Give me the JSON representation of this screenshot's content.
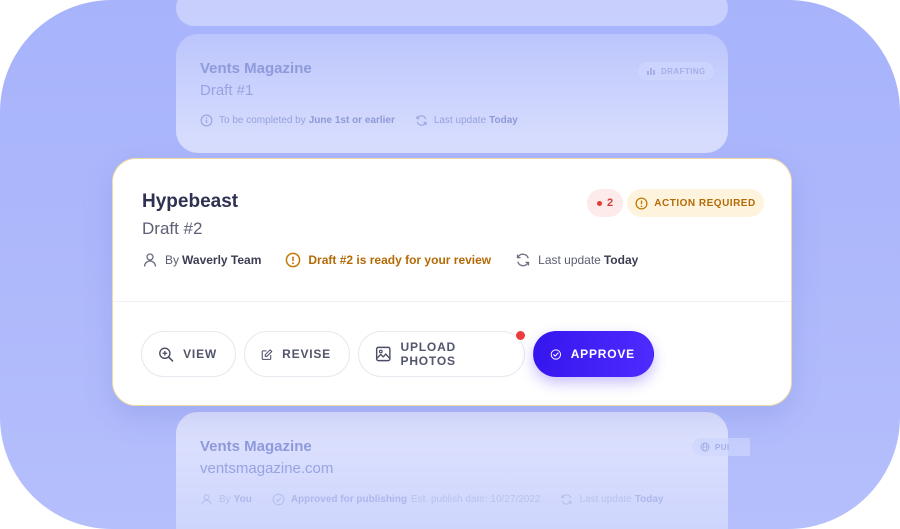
{
  "cards": {
    "top": {
      "title": "Vents Magazine",
      "subtitle": "Draft #1",
      "badge": "DRAFTING",
      "due_prefix": "To be completed by",
      "due_value": "June 1st or earlier",
      "update_prefix": "Last update",
      "update_value": "Today"
    },
    "main": {
      "title": "Hypebeast",
      "subtitle": "Draft #2",
      "count": "2",
      "status_badge": "ACTION REQUIRED",
      "author_prefix": "By",
      "author": "Waverly Team",
      "notice": "Draft #2 is ready for your review",
      "update_prefix": "Last update",
      "update_value": "Today",
      "buttons": {
        "view": "VIEW",
        "revise": "REVISE",
        "upload": "UPLOAD PHOTOS",
        "approve": "APPROVE"
      }
    },
    "bottom": {
      "title": "Vents Magazine",
      "subtitle": "ventsmagazine.com",
      "badge": "PUI",
      "author_prefix": "By",
      "author": "You",
      "status": "Approved for publishing",
      "publish_text": "Est. publish date: 10/27/2022",
      "update_prefix": "Last update",
      "update_value": "Today"
    }
  },
  "icons": {
    "user": "user-icon",
    "alert": "alert-circle-icon",
    "refresh": "refresh-icon",
    "info": "info-icon",
    "zoom": "zoom-in-icon",
    "edit": "edit-icon",
    "image": "image-icon",
    "check": "check-circle-icon",
    "globe": "globe-icon",
    "chart": "chart-icon"
  },
  "colors": {
    "accent": "#3f1ff5",
    "warning": "#b46a06",
    "warning_bg": "#fef4de",
    "danger": "#e53935",
    "background": "#aab5fb"
  }
}
